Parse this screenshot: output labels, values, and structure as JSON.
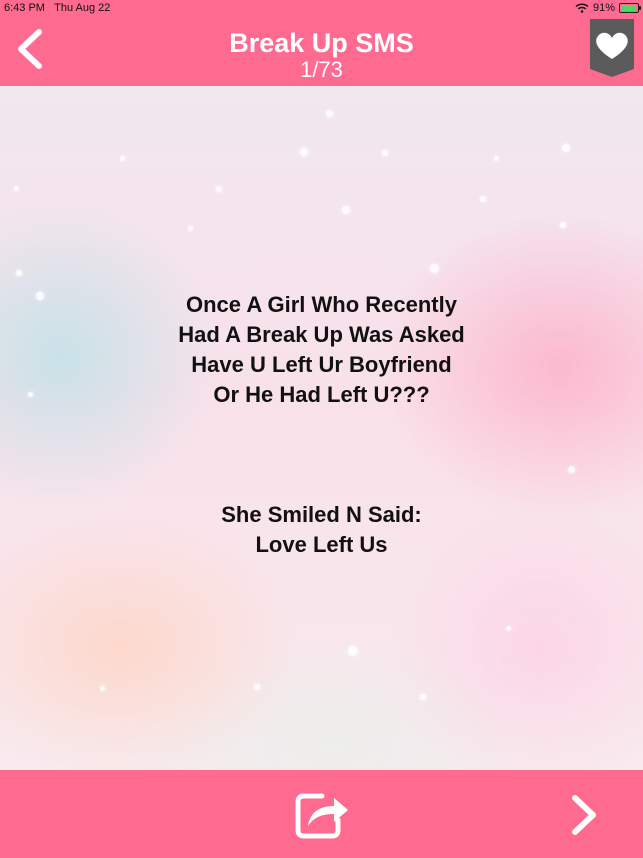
{
  "status_bar": {
    "time": "6:43 PM",
    "date": "Thu Aug 22",
    "battery": "91%",
    "battery_level": 0.91,
    "wifi_icon": "wifi-icon",
    "charging_icon": "bolt-icon"
  },
  "header": {
    "title": "Break Up SMS",
    "counter": "1/73",
    "back_icon": "chevron-left-icon",
    "favorite_icon": "heart-icon",
    "background_color": "#ff6a91"
  },
  "message": {
    "paragraph1": [
      "Once A Girl Who Recently",
      "Had A Break Up Was Asked",
      "Have U Left Ur Boyfriend",
      "Or He Had Left U???"
    ],
    "paragraph2": [
      "She Smiled N Said:",
      "Love Left Us"
    ]
  },
  "footer": {
    "share_icon": "share-icon",
    "next_icon": "chevron-right-icon",
    "background_color": "#ff6a91"
  }
}
